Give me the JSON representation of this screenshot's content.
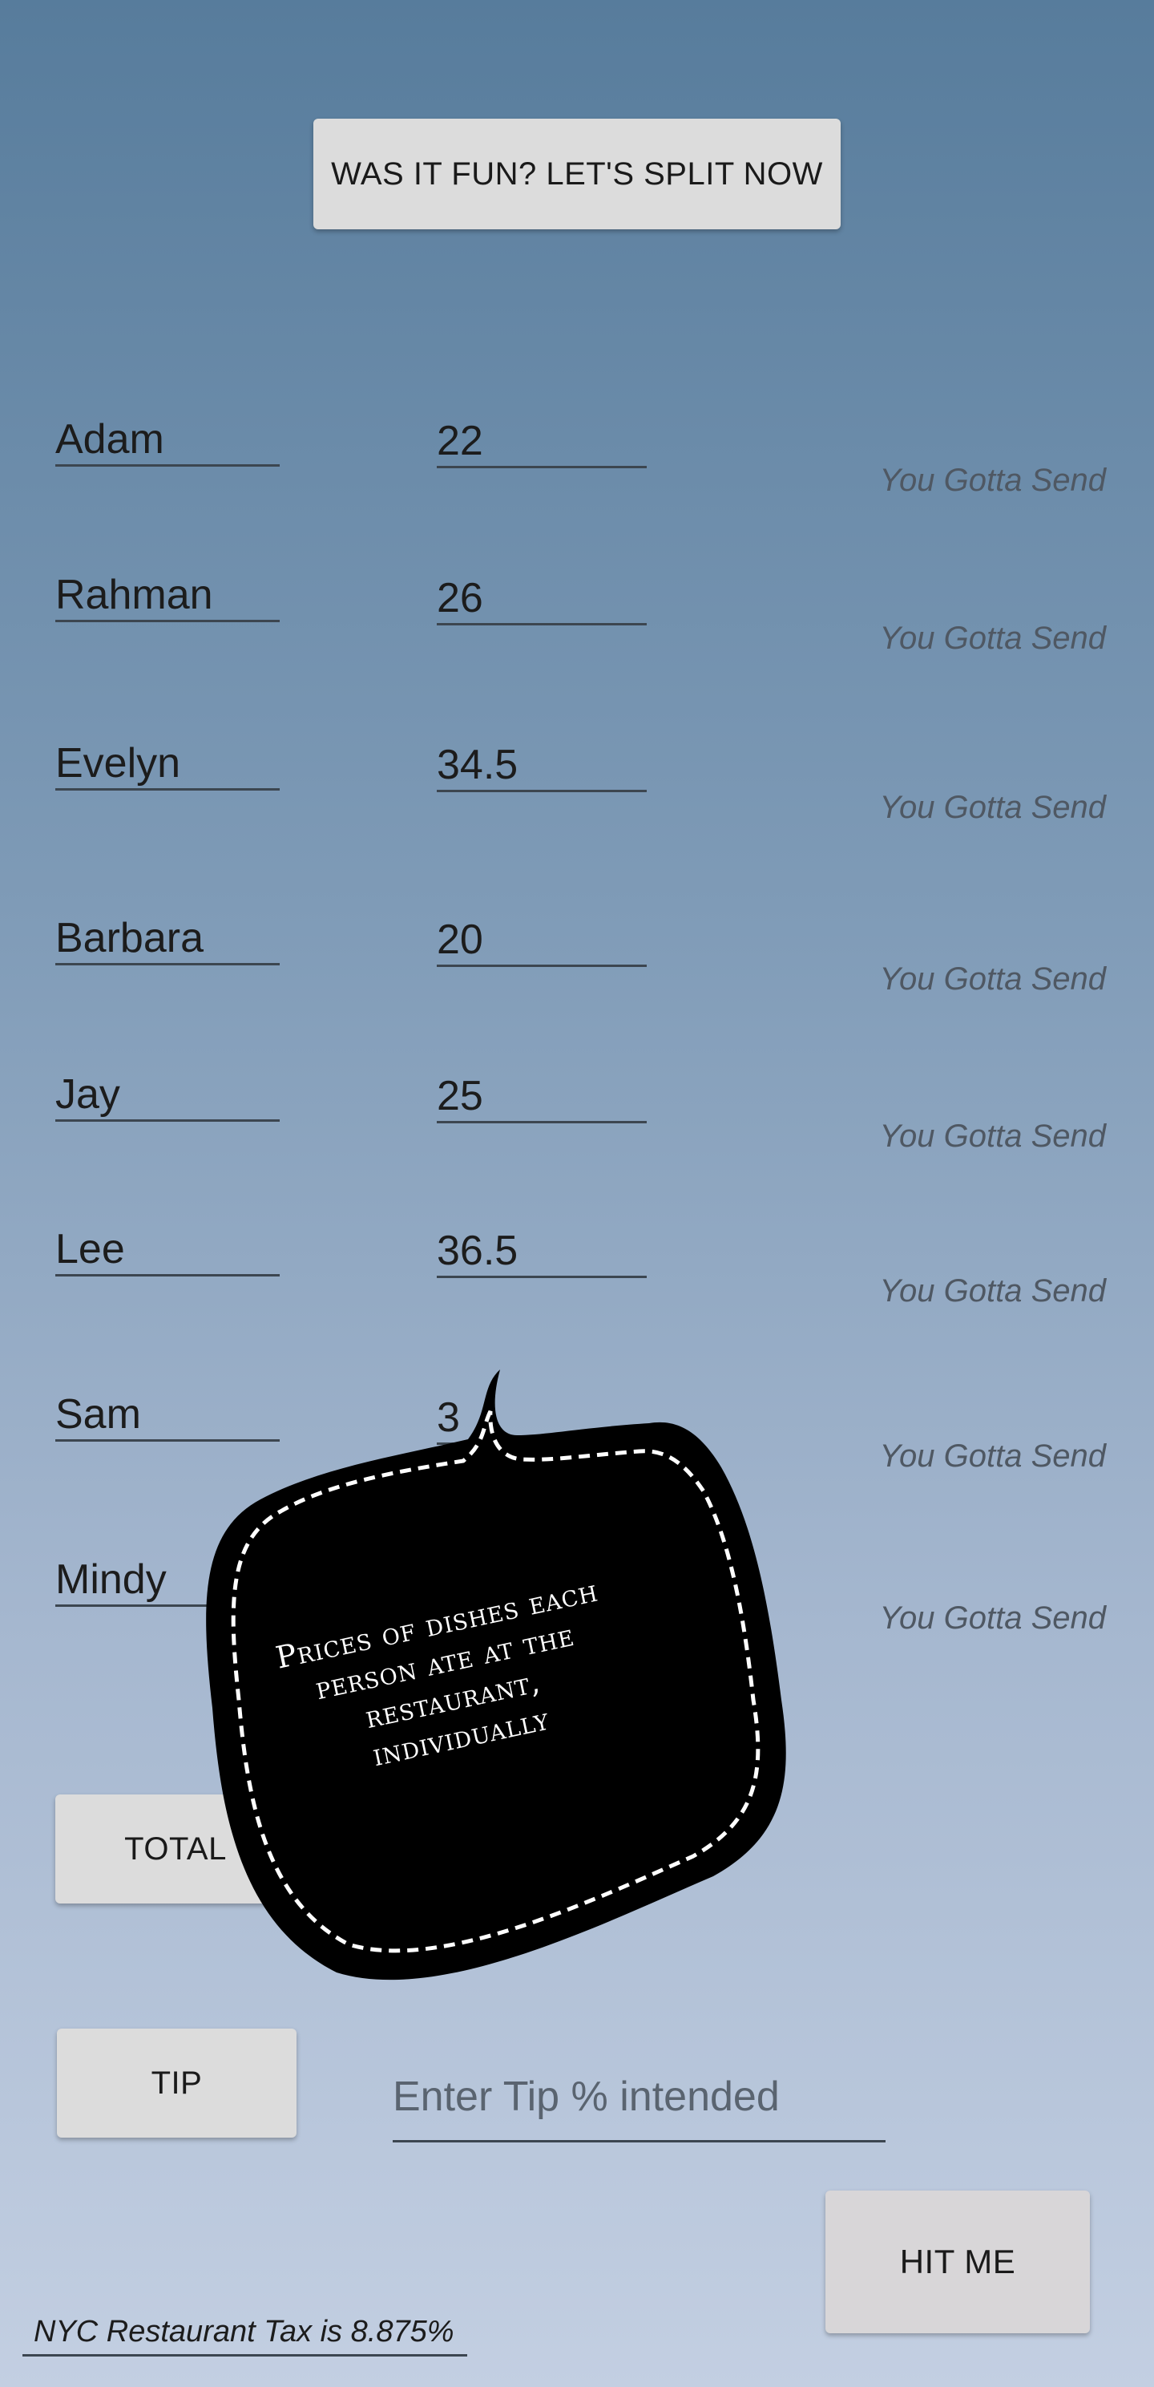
{
  "header": {
    "split_button_label": "WAS IT FUN?  LET'S SPLIT NOW"
  },
  "people": [
    {
      "name": "Adam",
      "price": "22",
      "result_label": "You Gotta Send"
    },
    {
      "name": "Rahman",
      "price": "26",
      "result_label": "You Gotta Send"
    },
    {
      "name": "Evelyn",
      "price": "34.5",
      "result_label": "You Gotta Send"
    },
    {
      "name": "Barbara",
      "price": "20",
      "result_label": "You Gotta Send"
    },
    {
      "name": "Jay",
      "price": "25",
      "result_label": "You Gotta Send"
    },
    {
      "name": "Lee",
      "price": "36.5",
      "result_label": "You Gotta Send"
    },
    {
      "name": "Sam",
      "price": "3",
      "result_label": "You Gotta Send"
    },
    {
      "name": "Mindy",
      "price": "",
      "result_label": "You Gotta Send"
    }
  ],
  "total": {
    "button_label": "TOTAL"
  },
  "tip": {
    "button_label": "TIP",
    "placeholder": "Enter Tip % intended"
  },
  "hit_me": {
    "button_label": "HIT ME"
  },
  "tax_note": "NYC Restaurant Tax is 8.875%",
  "tooltip": {
    "line1": "Prices of dishes each",
    "line2": "person ate at the restaurant,",
    "line3": "individually"
  },
  "colors": {
    "bg_top": "#577c9c",
    "bg_bottom": "#c3cfe2",
    "button_bg": "#dcdcdc",
    "bubble_bg": "#000000"
  }
}
